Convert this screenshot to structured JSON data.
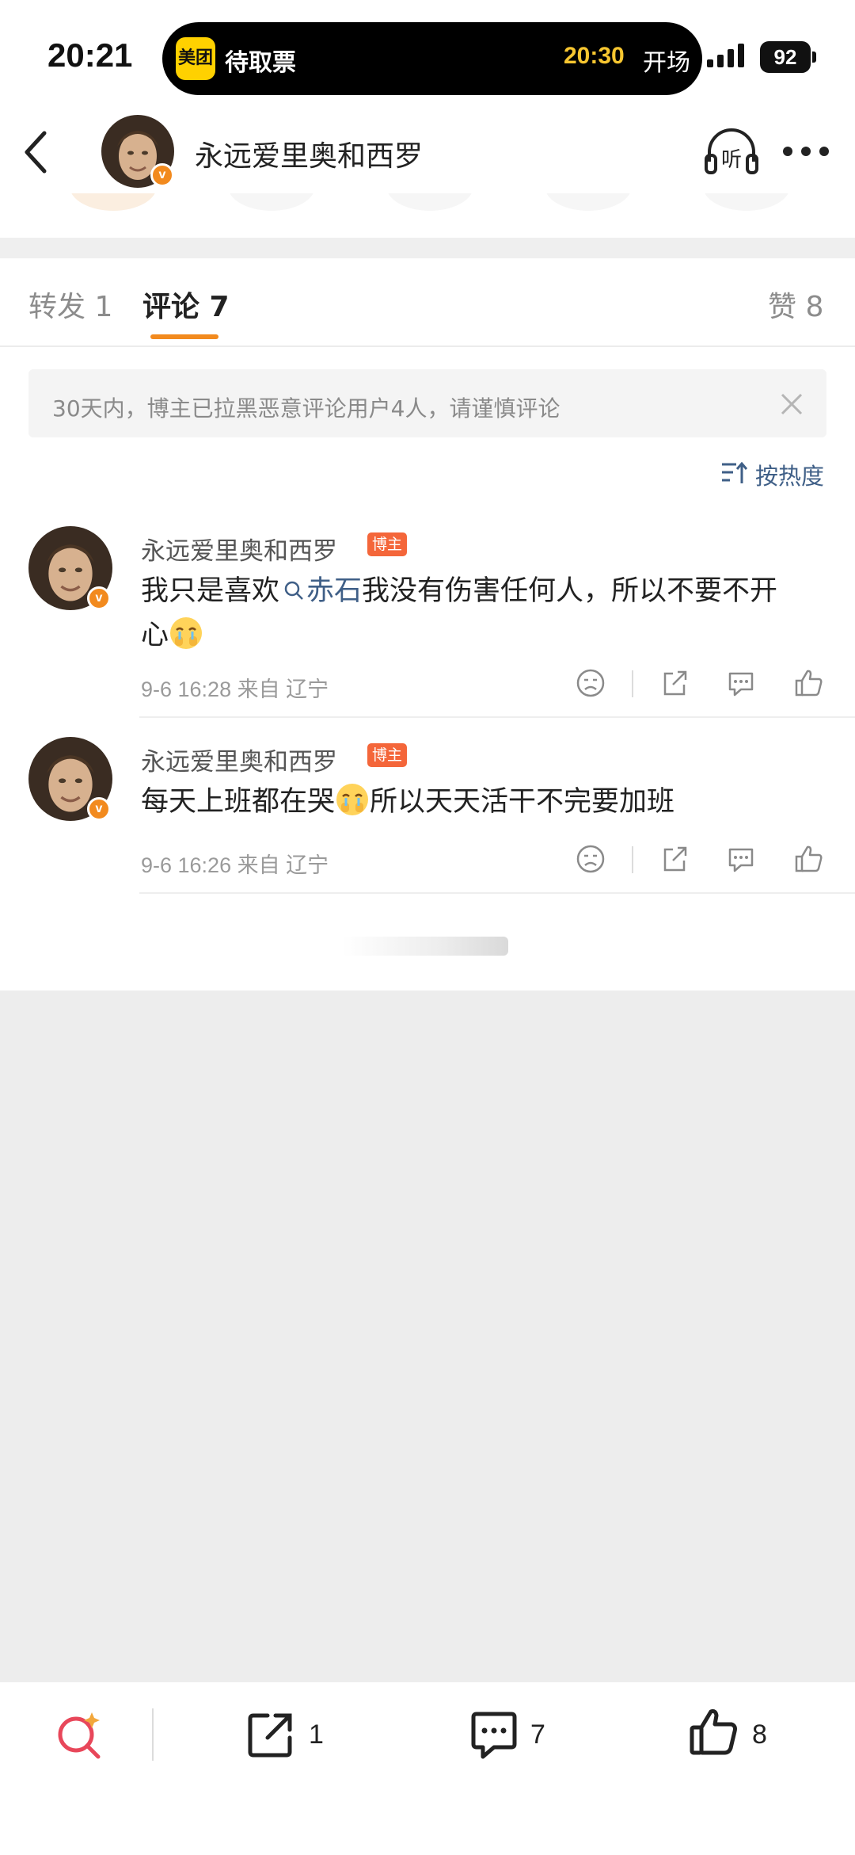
{
  "status_bar": {
    "time": "20:21",
    "island_app": "美团",
    "island_text": "待取票",
    "island_time": "20:30",
    "island_status": "开场",
    "battery": "92"
  },
  "nav": {
    "title": "永远爱里奥和西罗",
    "listen_label": "听"
  },
  "tabs": {
    "repost": "转发 1",
    "comment": "评论 7",
    "like": "赞 8"
  },
  "notice": "30天内，博主已拉黑恶意评论用户4人，请谨慎评论",
  "sort_label": "按热度",
  "comments": [
    {
      "name": "永远爱里奥和西罗",
      "tag": "博主",
      "text_before": "我只是喜欢",
      "topic": "赤石",
      "text_after": "我没有伤害任何人，所以不要不开",
      "text_line2": "心",
      "meta": "9-6 16:28  来自 辽宁"
    },
    {
      "name": "永远爱里奥和西罗",
      "tag": "博主",
      "text": "每天上班都在哭",
      "text_after": "所以天天活干不完要加班",
      "meta": "9-6 16:26  来自 辽宁"
    }
  ],
  "bottom_bar": {
    "repost_count": "1",
    "comment_count": "7",
    "like_count": "8"
  },
  "colors": {
    "accent": "#f28a1e",
    "link": "#3f5f87",
    "host_tag": "#f4663a"
  }
}
